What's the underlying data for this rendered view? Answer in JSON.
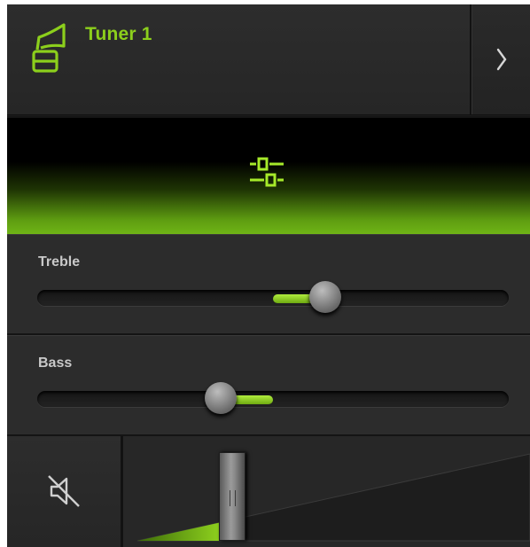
{
  "header": {
    "title": "Tuner 1",
    "source_icon": "tuner-icon",
    "next_icon": "chevron-right-icon"
  },
  "eq": {
    "icon": "equalizer-icon"
  },
  "treble": {
    "label": "Treble",
    "value": 0.61,
    "center": 0.5
  },
  "bass": {
    "label": "Bass",
    "value": 0.39,
    "center": 0.5
  },
  "volume": {
    "mute_icon": "speaker-muted-icon",
    "level": 0.24
  },
  "colors": {
    "accent": "#8ccf1c",
    "background": "#1b1b1b",
    "panel": "#2c2c2c"
  }
}
